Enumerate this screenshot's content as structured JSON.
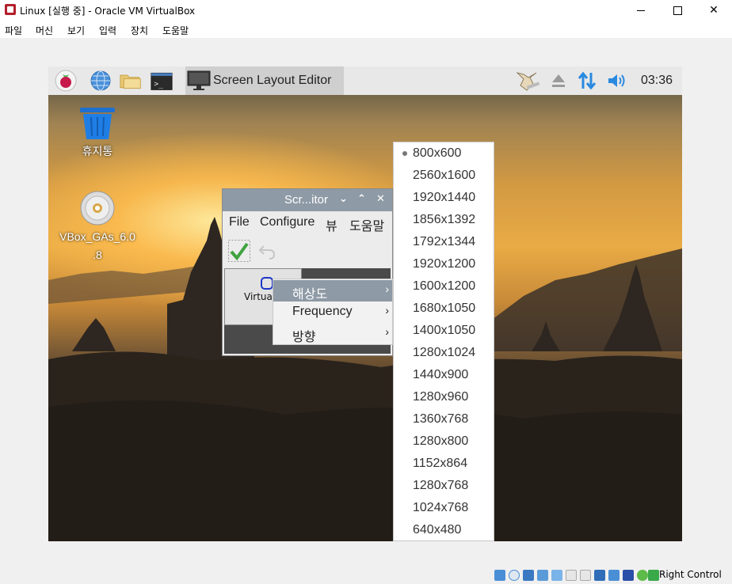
{
  "window": {
    "title": "Linux [실행 중] - Oracle VM VirtualBox"
  },
  "host_menu": [
    "파일",
    "머신",
    "보기",
    "입력",
    "장치",
    "도움말"
  ],
  "taskbar": {
    "task_label": "Screen Layout Editor",
    "clock": "03:36"
  },
  "desktop": {
    "trash_label": "휴지통",
    "cd_label_line1": "VBox_GAs_6.0",
    "cd_label_line2": ".8"
  },
  "editor": {
    "title": "Scr...itor",
    "menu": [
      "File",
      "Configure",
      "뷰",
      "도움말"
    ],
    "monitor_label": "Virtua"
  },
  "context_menu": [
    {
      "label": "해상도",
      "active": true
    },
    {
      "label": "Frequency",
      "active": false
    },
    {
      "label": "방향",
      "active": false
    }
  ],
  "resolutions": [
    "800x600",
    "2560x1600",
    "1920x1440",
    "1856x1392",
    "1792x1344",
    "1920x1200",
    "1600x1200",
    "1680x1050",
    "1400x1050",
    "1280x1024",
    "1440x900",
    "1280x960",
    "1360x768",
    "1280x800",
    "1152x864",
    "1280x768",
    "1024x768",
    "640x480"
  ],
  "selected_resolution": "800x600",
  "status": {
    "host_key": "Right Control"
  },
  "colors": {
    "accent": "#8e9aa5",
    "sunset": "#e9ab45"
  }
}
